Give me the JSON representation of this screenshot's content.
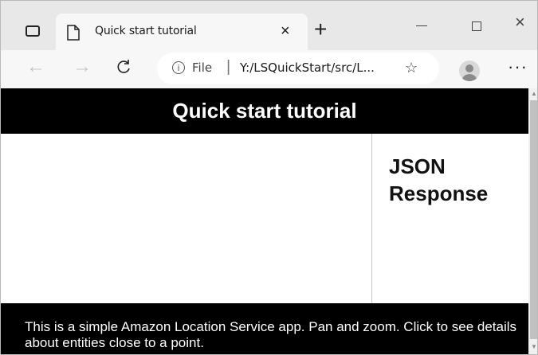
{
  "browser": {
    "tab": {
      "title": "Quick start tutorial",
      "close_glyph": "×"
    },
    "new_tab_glyph": "+",
    "window_controls": {
      "minimize": "",
      "maximize": "",
      "close_glyph": "×"
    },
    "nav": {
      "back_glyph": "←",
      "forward_glyph": "→",
      "reload_glyph": "C"
    },
    "address": {
      "info_glyph": "i",
      "scheme_label": "File",
      "separator": "|",
      "url": "Y:/LSQuickStart/src/L..."
    },
    "favorites_glyph": "☆",
    "more_glyph": "···"
  },
  "page": {
    "title": "Quick start tutorial",
    "side_heading": "JSON Response",
    "footer_text": "This is a simple Amazon Location Service app. Pan and zoom. Click to see details about entities close to a point."
  },
  "colors": {
    "header_bg": "#000000",
    "footer_bg": "#000000",
    "tabbar_bg": "#e8e8e8",
    "addressbar_bg": "#f7f7f7"
  }
}
